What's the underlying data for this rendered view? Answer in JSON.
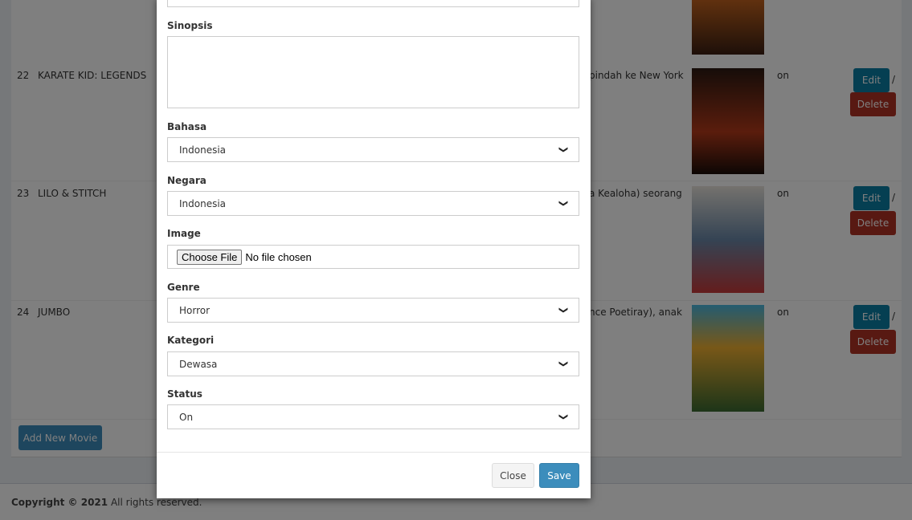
{
  "table": {
    "rows": [
      {
        "no": "22",
        "title": "KARATE KID: LEGENDS",
        "synopsis": "pindah ke New York",
        "status": "on"
      },
      {
        "no": "23",
        "title": "LILO & STITCH",
        "synopsis": "a Kealoha) seorang",
        "status": "on"
      },
      {
        "no": "24",
        "title": "JUMBO",
        "synopsis": "nce Poetiray), anak",
        "status": "on"
      }
    ],
    "edit_label": "Edit",
    "delete_label": "Delete",
    "separator": "/",
    "add_label": "Add New Movie"
  },
  "footer": {
    "copyright": "Copyright © 2021",
    "rights": " All rights reserved."
  },
  "modal": {
    "sinopsis_label": "Sinopsis",
    "sinopsis_value": "",
    "bahasa_label": "Bahasa",
    "bahasa_value": "Indonesia",
    "negara_label": "Negara",
    "negara_value": "Indonesia",
    "image_label": "Image",
    "file_button": "Choose File",
    "file_status": "No file chosen",
    "genre_label": "Genre",
    "genre_value": "Horror",
    "kategori_label": "Kategori",
    "kategori_value": "Dewasa",
    "status_label": "Status",
    "status_value": "On",
    "close_label": "Close",
    "save_label": "Save"
  },
  "colors": {
    "primary": "#3c8dbc",
    "edit": "#0b7ea5",
    "delete": "#b03225"
  },
  "icons": {
    "select_arrow": "chevron-down-icon"
  }
}
